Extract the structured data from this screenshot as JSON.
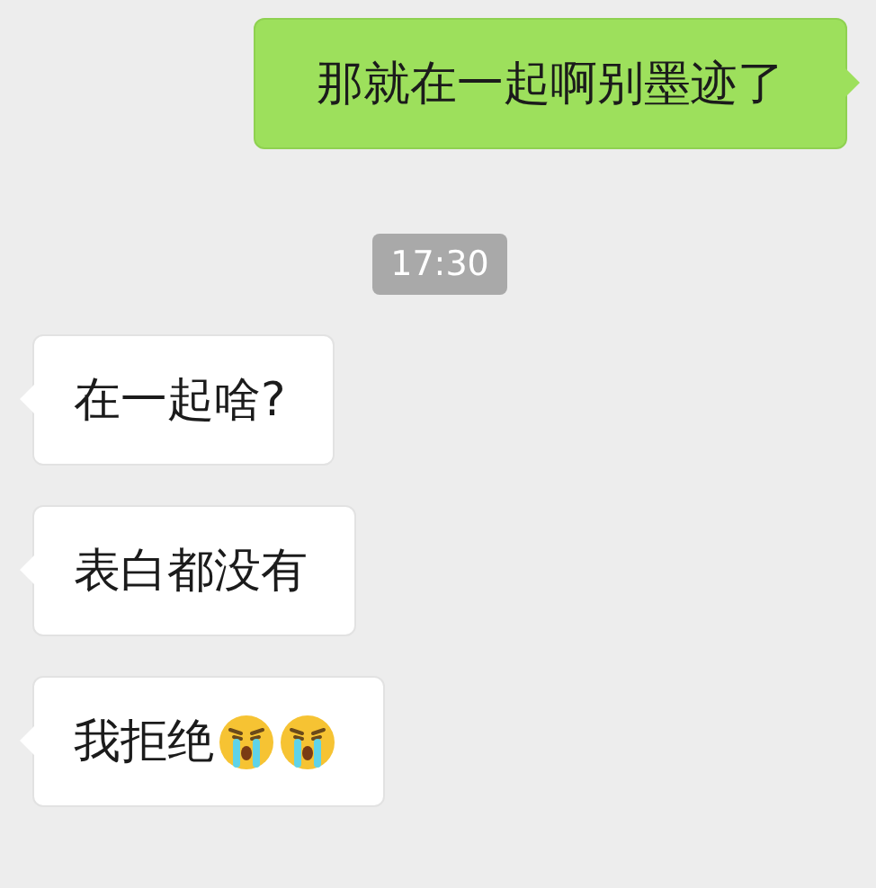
{
  "messages": [
    {
      "kind": "sent",
      "parts": [
        {
          "kind": "text",
          "text": "那就在一起啊别墨迹了"
        }
      ]
    },
    {
      "kind": "time",
      "text": "17:30"
    },
    {
      "kind": "received",
      "parts": [
        {
          "kind": "text",
          "text": "在一起啥?"
        }
      ]
    },
    {
      "kind": "received",
      "parts": [
        {
          "kind": "text",
          "text": "表白都没有"
        }
      ]
    },
    {
      "kind": "received",
      "parts": [
        {
          "kind": "text",
          "text": "我拒绝"
        },
        {
          "kind": "emoji"
        },
        {
          "kind": "emoji"
        }
      ]
    }
  ]
}
